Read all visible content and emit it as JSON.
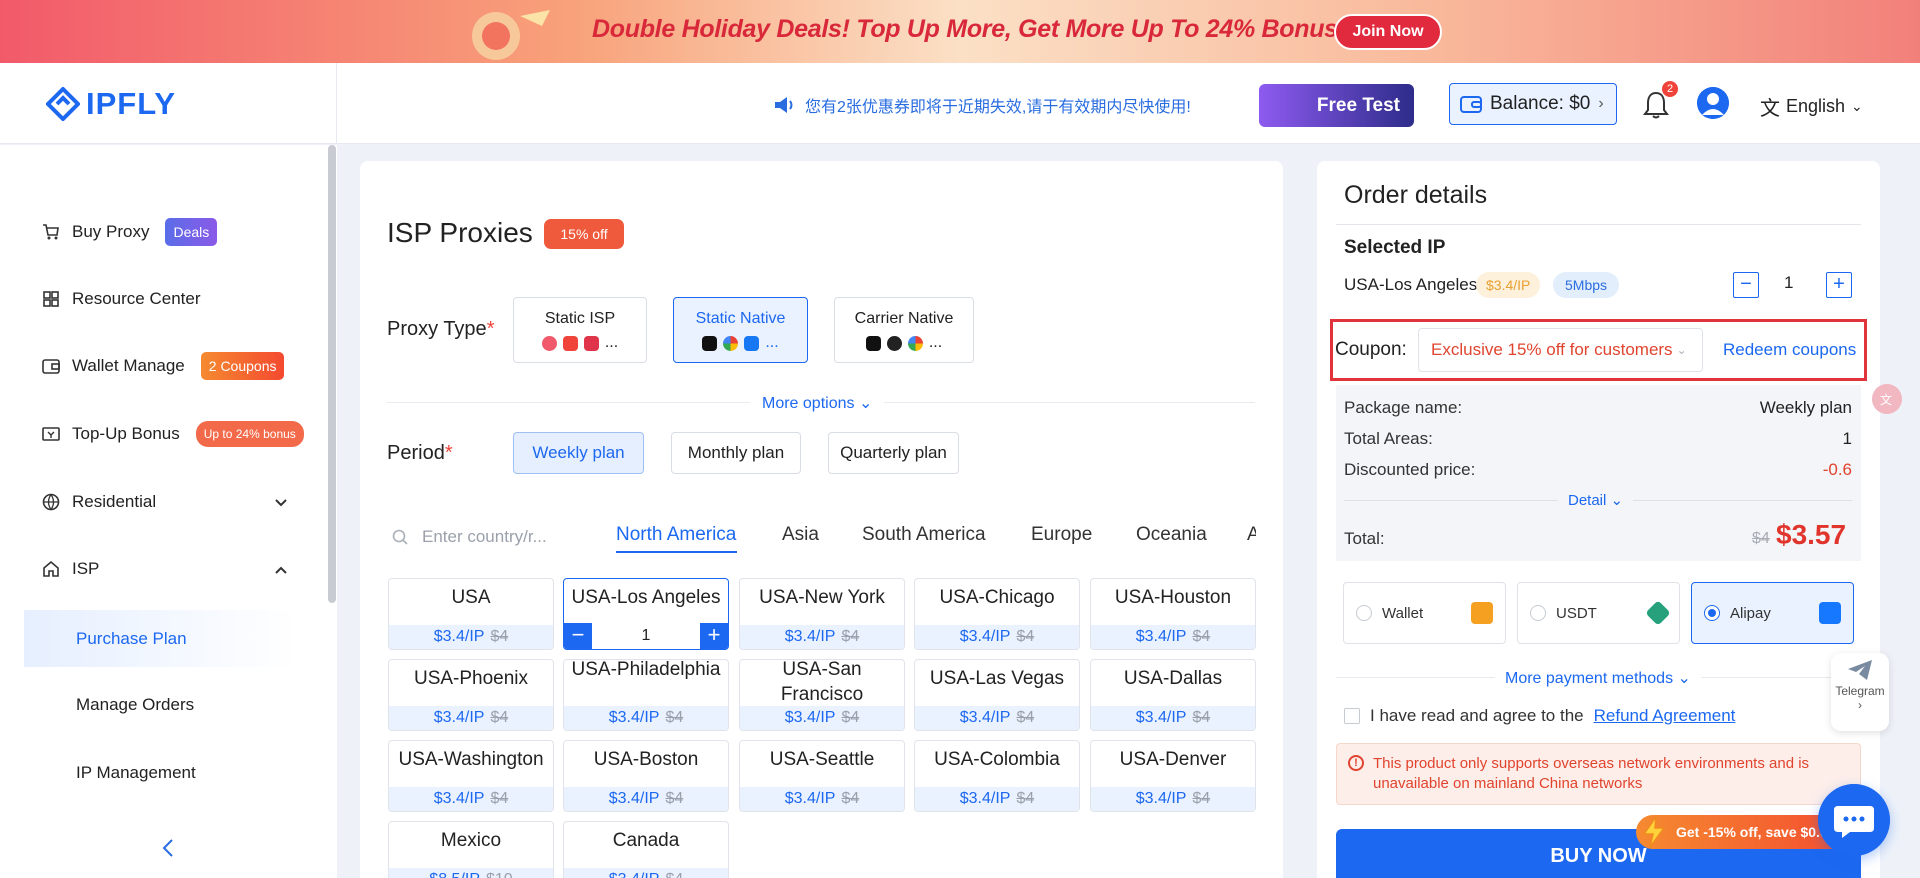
{
  "banner": {
    "text": "Double Holiday Deals! Top Up More, Get More Up To 24% Bonus!",
    "join_label": "Join Now"
  },
  "header": {
    "logo": "IPFLY",
    "notice": "您有2张优惠券即将于近期失效,请于有效期内尽快使用!",
    "free_test": "Free Test",
    "balance": "Balance: $0",
    "bell_count": "2",
    "language": "English"
  },
  "sidebar": {
    "items": [
      {
        "label": "Buy Proxy",
        "badge": "Deals",
        "icon": "cart-icon"
      },
      {
        "label": "Resource Center",
        "icon": "grid-icon"
      },
      {
        "label": "Wallet Manage",
        "badge": "2 Coupons",
        "icon": "wallet-icon"
      },
      {
        "label": "Top-Up Bonus",
        "badge": "Up to 24% bonus",
        "icon": "ticket-icon"
      },
      {
        "label": "Residential",
        "icon": "globe-icon"
      },
      {
        "label": "ISP",
        "icon": "home-icon"
      }
    ],
    "sub_items": [
      "Purchase Plan",
      "Manage Orders",
      "IP Management"
    ]
  },
  "main": {
    "title": "ISP Proxies",
    "discount_badge": "15% off",
    "proxy_type_label": "Proxy Type",
    "proxy_types": [
      {
        "label": "Static ISP",
        "more": "..."
      },
      {
        "label": "Static Native",
        "more": "...",
        "selected": true
      },
      {
        "label": "Carrier Native",
        "more": "..."
      }
    ],
    "more_options": "More options",
    "period_label": "Period",
    "periods": [
      "Weekly plan",
      "Monthly plan",
      "Quarterly plan"
    ],
    "search_placeholder": "Enter country/r...",
    "region_tabs": [
      "North America",
      "Asia",
      "South America",
      "Europe",
      "Oceania",
      "A"
    ],
    "cities": [
      {
        "name": "USA",
        "price": "$3.4/IP",
        "old": "$4"
      },
      {
        "name": "USA-Los Angeles",
        "qty": "1",
        "selected": true
      },
      {
        "name": "USA-New York",
        "price": "$3.4/IP",
        "old": "$4"
      },
      {
        "name": "USA-Chicago",
        "price": "$3.4/IP",
        "old": "$4"
      },
      {
        "name": "USA-Houston",
        "price": "$3.4/IP",
        "old": "$4"
      },
      {
        "name": "USA-Phoenix",
        "price": "$3.4/IP",
        "old": "$4"
      },
      {
        "name": "USA-Philadelphia",
        "price": "$3.4/IP",
        "old": "$4"
      },
      {
        "name": "USA-San Francisco",
        "price": "$3.4/IP",
        "old": "$4"
      },
      {
        "name": "USA-Las Vegas",
        "price": "$3.4/IP",
        "old": "$4"
      },
      {
        "name": "USA-Dallas",
        "price": "$3.4/IP",
        "old": "$4"
      },
      {
        "name": "USA-Washington",
        "price": "$3.4/IP",
        "old": "$4"
      },
      {
        "name": "USA-Boston",
        "price": "$3.4/IP",
        "old": "$4"
      },
      {
        "name": "USA-Seattle",
        "price": "$3.4/IP",
        "old": "$4"
      },
      {
        "name": "USA-Colombia",
        "price": "$3.4/IP",
        "old": "$4"
      },
      {
        "name": "USA-Denver",
        "price": "$3.4/IP",
        "old": "$4"
      },
      {
        "name": "Mexico",
        "price": "$8.5/IP",
        "old": "$10"
      },
      {
        "name": "Canada",
        "price": "$3.4/IP",
        "old": "$4"
      }
    ]
  },
  "order": {
    "title": "Order details",
    "selected_ip_label": "Selected IP",
    "city": "USA-Los Angeles",
    "price_tag": "$3.4/IP",
    "speed_tag": "5Mbps",
    "qty": "1",
    "coupon_label": "Coupon:",
    "coupon_value": "Exclusive 15% off for customers",
    "redeem": "Redeem coupons",
    "summary": [
      {
        "label": "Package name:",
        "value": "Weekly plan"
      },
      {
        "label": "Total Areas:",
        "value": "1"
      },
      {
        "label": "Discounted price:",
        "value": "-0.6"
      }
    ],
    "detail": "Detail",
    "total_label": "Total:",
    "total_old": "$4",
    "total": "$3.57",
    "payments": [
      {
        "label": "Wallet"
      },
      {
        "label": "USDT"
      },
      {
        "label": "Alipay",
        "selected": true
      }
    ],
    "more_payments": "More payment methods",
    "agree_text": "I have read and agree to the",
    "agree_link": "Refund Agreement",
    "warning": "This product only supports overseas network environments and is unavailable on mainland China networks",
    "buy": "BUY NOW",
    "promo": "Get -15% off, save $0.6"
  },
  "floats": {
    "telegram": "Telegram"
  },
  "colors": {
    "primary": "#1c68f0",
    "accent_red": "#e0342c",
    "banner_red": "#d8283a"
  }
}
